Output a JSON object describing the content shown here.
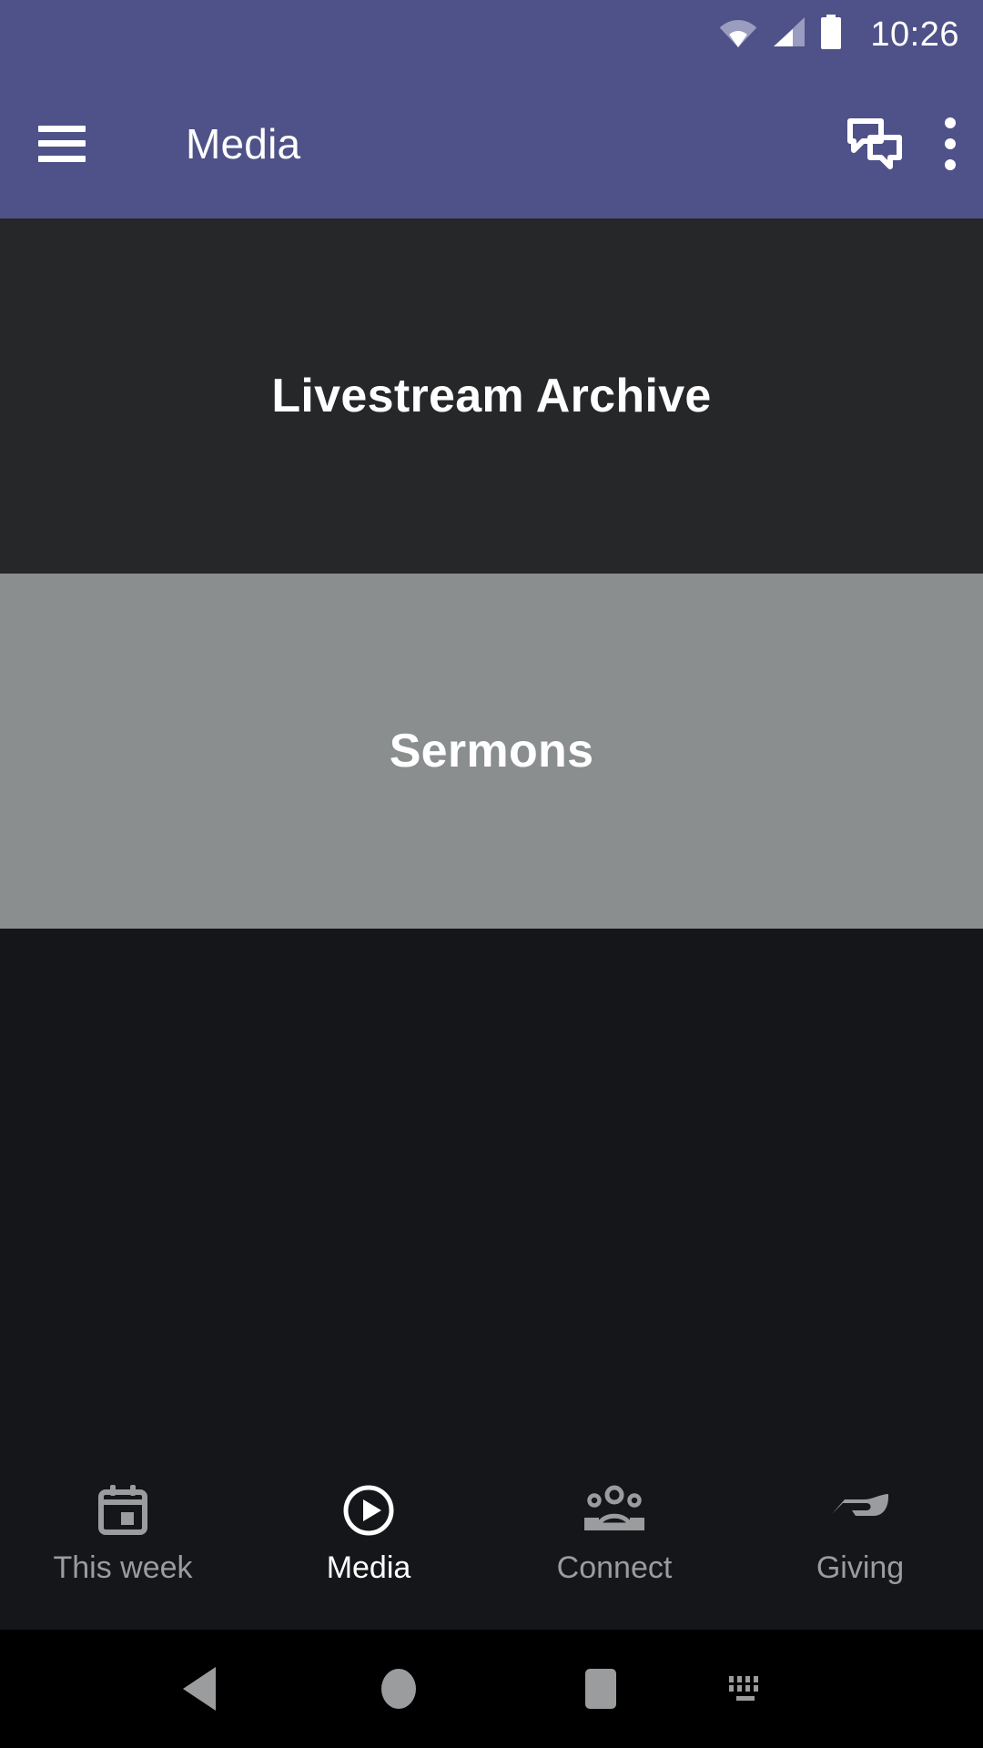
{
  "status_bar": {
    "time": "10:26",
    "icons": [
      "wifi-icon",
      "cell-signal-icon",
      "battery-icon"
    ]
  },
  "app_bar": {
    "menu_icon": "hamburger-menu-icon",
    "title": "Media",
    "chat_icon": "chat-bubbles-icon",
    "overflow_icon": "more-vert-icon",
    "background_color": "#4F5288"
  },
  "main": {
    "cards": [
      {
        "title": "Livestream Archive",
        "background_color": "#262728",
        "text_color": "#FFFFFF"
      },
      {
        "title": "Sermons",
        "background_color": "#8A8E8E",
        "text_color": "#FFFFFF"
      }
    ]
  },
  "bottom_nav": {
    "items": [
      {
        "label": "This week",
        "icon": "calendar-icon",
        "active": false
      },
      {
        "label": "Media",
        "icon": "play-circle-icon",
        "active": true
      },
      {
        "label": "Connect",
        "icon": "people-group-icon",
        "active": false
      },
      {
        "label": "Giving",
        "icon": "open-hand-icon",
        "active": false
      }
    ],
    "active_color": "#FFFFFF",
    "inactive_color": "#9A9C9E"
  },
  "system_nav": {
    "back": "back-triangle-icon",
    "home": "home-circle-icon",
    "recents": "recents-square-icon",
    "keyboard": "keyboard-icon"
  }
}
